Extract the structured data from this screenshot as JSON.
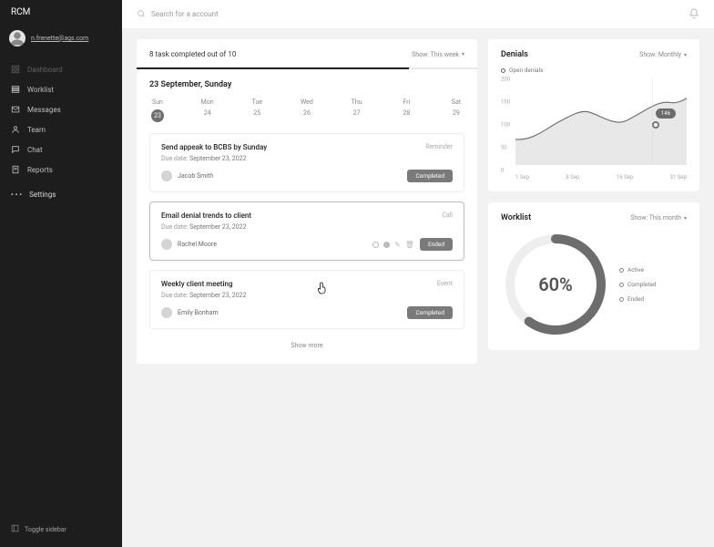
{
  "brand": "RCM",
  "profile": {
    "name": "",
    "email": "n.frenette@ags.com"
  },
  "nav": [
    {
      "icon": "grid",
      "label": "Dashboard",
      "dim": true
    },
    {
      "icon": "list",
      "label": "Worklist"
    },
    {
      "icon": "mail",
      "label": "Messages"
    },
    {
      "icon": "user",
      "label": "Team"
    },
    {
      "icon": "chat",
      "label": "Chat"
    },
    {
      "icon": "doc",
      "label": "Reports"
    }
  ],
  "settings_label": "Settings",
  "toggle_label": "Toggle sidebar",
  "search": {
    "placeholder": "Search for a account"
  },
  "tasks_card": {
    "summary": "8 task completed out of 10",
    "filter_label": "Show: This week",
    "date_heading": "23 September, Sunday",
    "weekdays": [
      "Sun",
      "Mon",
      "Tue",
      "Wed",
      "Thu",
      "Fri",
      "Sat"
    ],
    "days": [
      "23",
      "24",
      "25",
      "26",
      "27",
      "28",
      "29"
    ],
    "selected_index": 0,
    "show_more": "Show more",
    "items": [
      {
        "title": "Send appeak to BCBS  by Sunday",
        "due_label": "Due date:",
        "due": "September 23, 2022",
        "assignee": "Jacob Smith",
        "tag": "Reminder",
        "status": "Completed",
        "highlight": false,
        "show_icons": false
      },
      {
        "title": "Email denial trends to client",
        "due_label": "Due date:",
        "due": "September 23, 2022",
        "assignee": "Rachel Moore",
        "tag": "Call",
        "status": "Ended",
        "highlight": true,
        "show_icons": true
      },
      {
        "title": "Weekly client meeting",
        "due_label": "Due date:",
        "due": "September 23, 2022",
        "assignee": "Emily Bonham",
        "tag": "Event",
        "status": "Completed",
        "highlight": false,
        "show_icons": false
      }
    ]
  },
  "denials_card": {
    "title": "Denials",
    "filter_label": "Show: Monthly",
    "legend": "Open denials",
    "callout": "146",
    "yticks": [
      "200",
      "150",
      "100",
      "50",
      "0"
    ],
    "xticks": [
      "1 Sep",
      "8 Sep",
      "16 Sep",
      "31 Sep"
    ]
  },
  "chart_data": {
    "type": "area",
    "title": "Denials",
    "series_name": "Open denials",
    "x": [
      "1 Sep",
      "8 Sep",
      "16 Sep",
      "31 Sep"
    ],
    "values": [
      60,
      100,
      110,
      150
    ],
    "peak_local": {
      "x_approx": "10 Sep",
      "value": 125
    },
    "callout_point": {
      "x": "24 Sep",
      "value": 146
    },
    "ylabel": "",
    "xlabel": "",
    "ylim": [
      0,
      200
    ]
  },
  "worklist_card": {
    "title": "Worklist",
    "filter_label": "Show: This month",
    "percent": "60%",
    "percent_num": 60,
    "legend": [
      "Active",
      "Completed",
      "Ended"
    ]
  }
}
